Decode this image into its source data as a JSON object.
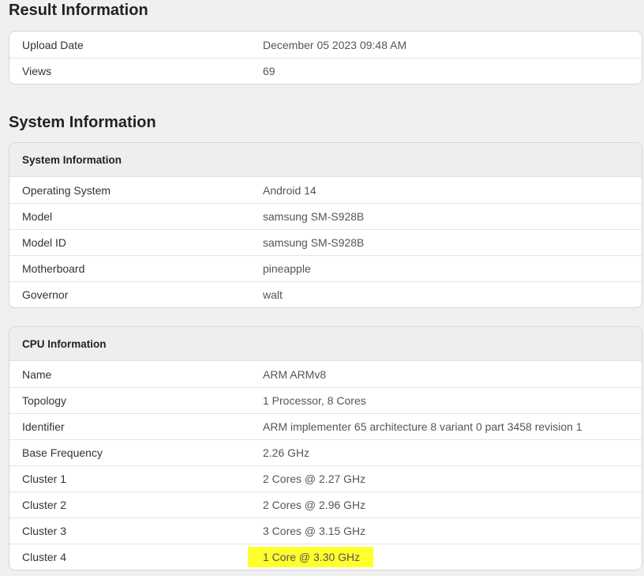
{
  "result": {
    "title": "Result Information",
    "rows": [
      {
        "label": "Upload Date",
        "value": "December 05 2023 09:48 AM"
      },
      {
        "label": "Views",
        "value": "69"
      }
    ]
  },
  "system": {
    "title": "System Information",
    "system_card": {
      "header": "System Information",
      "rows": [
        {
          "label": "Operating System",
          "value": "Android 14"
        },
        {
          "label": "Model",
          "value": "samsung SM-S928B"
        },
        {
          "label": "Model ID",
          "value": "samsung SM-S928B"
        },
        {
          "label": "Motherboard",
          "value": "pineapple"
        },
        {
          "label": "Governor",
          "value": "walt"
        }
      ]
    },
    "cpu_card": {
      "header": "CPU Information",
      "rows": [
        {
          "label": "Name",
          "value": "ARM ARMv8"
        },
        {
          "label": "Topology",
          "value": "1 Processor, 8 Cores"
        },
        {
          "label": "Identifier",
          "value": "ARM implementer 65 architecture 8 variant 0 part 3458 revision 1"
        },
        {
          "label": "Base Frequency",
          "value": "2.26 GHz"
        },
        {
          "label": "Cluster 1",
          "value": "2 Cores @ 2.27 GHz"
        },
        {
          "label": "Cluster 2",
          "value": "2 Cores @ 2.96 GHz"
        },
        {
          "label": "Cluster 3",
          "value": "3 Cores @ 3.15 GHz"
        },
        {
          "label": "Cluster 4",
          "value": "1 Core @ 3.30 GHz"
        }
      ]
    }
  },
  "colors": {
    "highlight": "#ffff2e",
    "background": "#f0f0f0",
    "card_header_bg": "#eeeeee"
  }
}
